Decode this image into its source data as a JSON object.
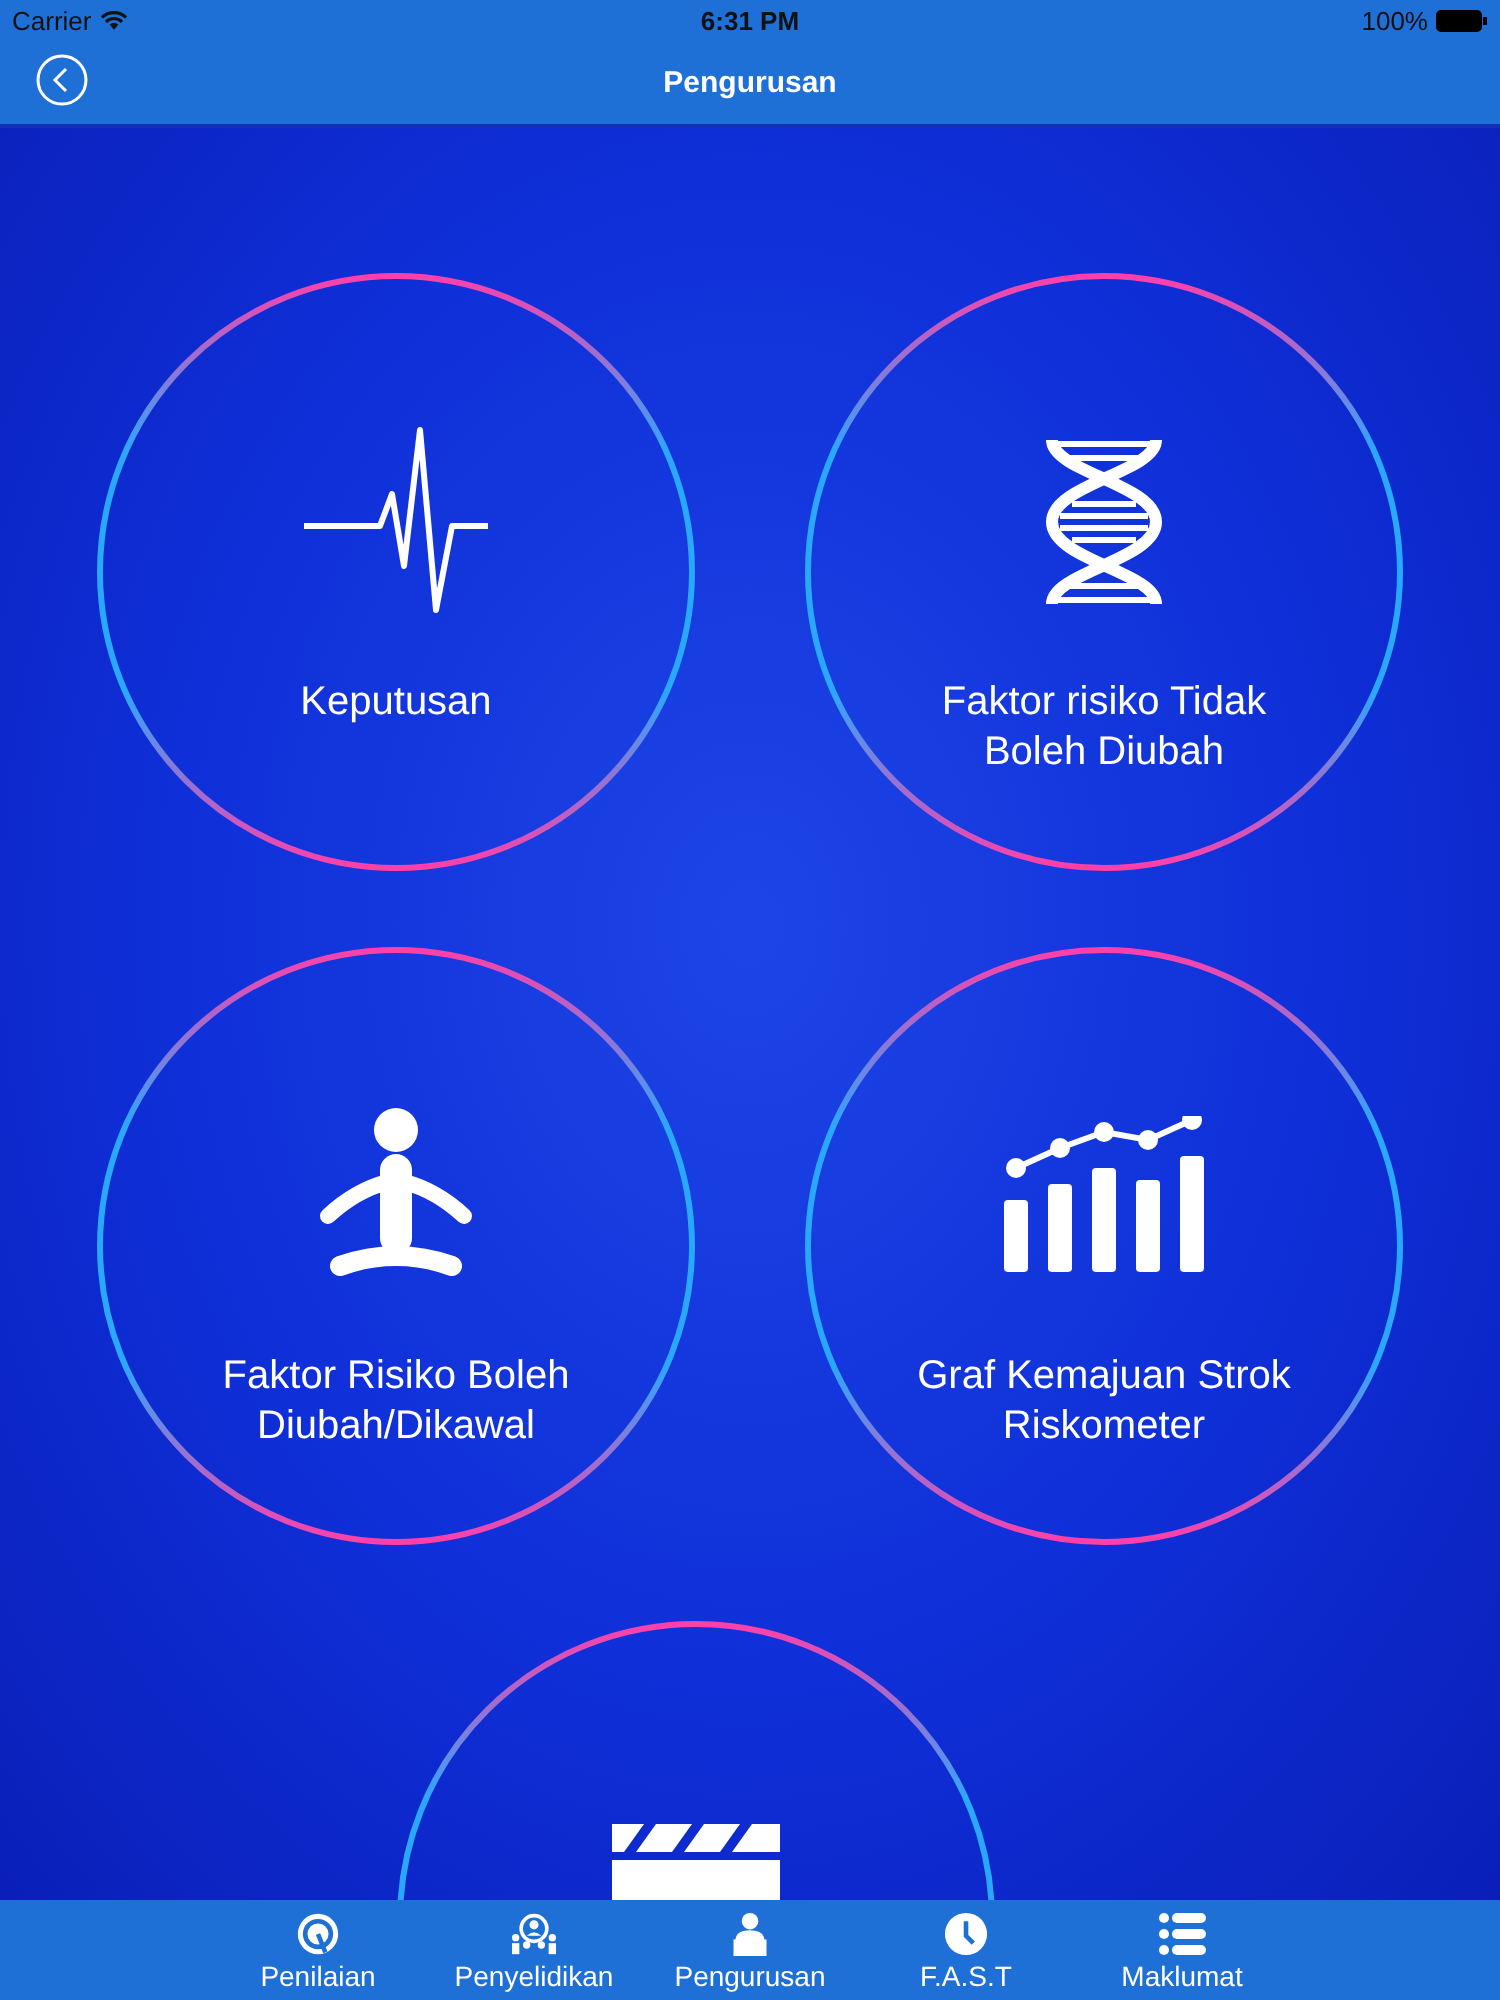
{
  "status_bar": {
    "carrier": "Carrier",
    "time": "6:31 PM",
    "battery": "100%"
  },
  "nav_bar": {
    "title": "Pengurusan"
  },
  "cards": [
    {
      "kind": "circle",
      "label": "Keputusan"
    },
    {
      "kind": "circle",
      "label": "Faktor risiko Tidak Boleh Diubah"
    },
    {
      "kind": "circle",
      "label": "Faktor Risiko Boleh Diubah/Dikawal"
    },
    {
      "kind": "circle",
      "label": "Graf Kemajuan Strok Riskometer"
    },
    {
      "kind": "circle"
    }
  ],
  "tab_bar": [
    {
      "label": "Penilaian"
    },
    {
      "label": "Penyelidikan"
    },
    {
      "label": "Pengurusan"
    },
    {
      "label": "F.A.S.T"
    },
    {
      "label": "Maklumat"
    }
  ]
}
